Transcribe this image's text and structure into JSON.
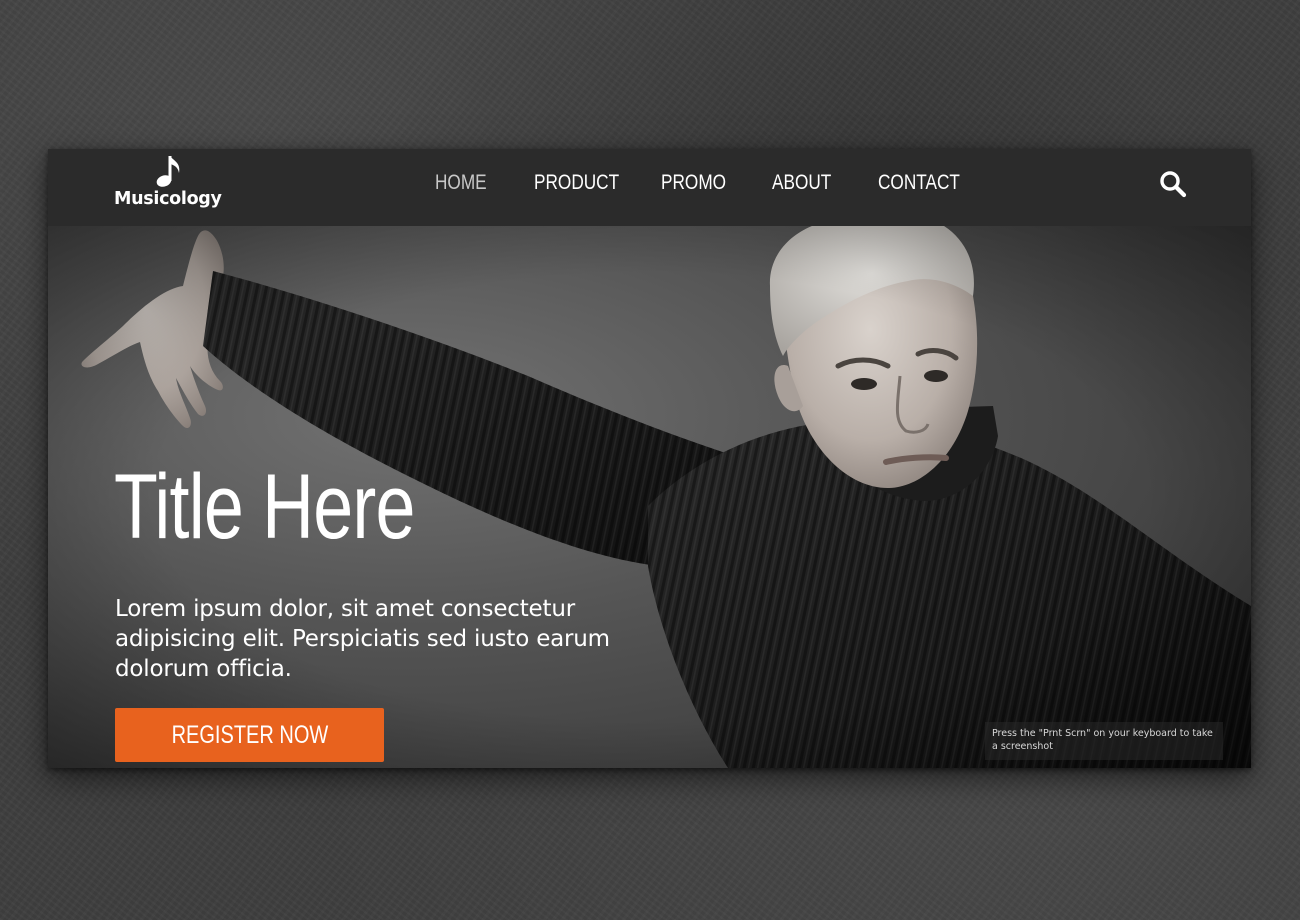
{
  "brand": {
    "name": "Musicology",
    "logo_icon": "music-note-icon"
  },
  "nav": {
    "items": [
      {
        "label": "HOME",
        "active": true
      },
      {
        "label": "PRODUCT",
        "active": false
      },
      {
        "label": "PROMO",
        "active": false
      },
      {
        "label": "ABOUT",
        "active": false
      },
      {
        "label": "CONTACT",
        "active": false
      }
    ],
    "search_icon": "search-icon"
  },
  "hero": {
    "title": "Title Here",
    "body": "Lorem ipsum dolor, sit amet consectetur adipisicing elit. Perspiciatis sed iusto earum dolorum officia.",
    "cta_label": "REGISTER NOW"
  },
  "tooltip": {
    "text": "Press the \"Prnt Scrn\" on your keyboard to take a screenshot"
  },
  "colors": {
    "accent": "#e8621e",
    "navbar": "#2b2b2b",
    "nav_active": "#c8c8c8",
    "text": "#ffffff"
  }
}
